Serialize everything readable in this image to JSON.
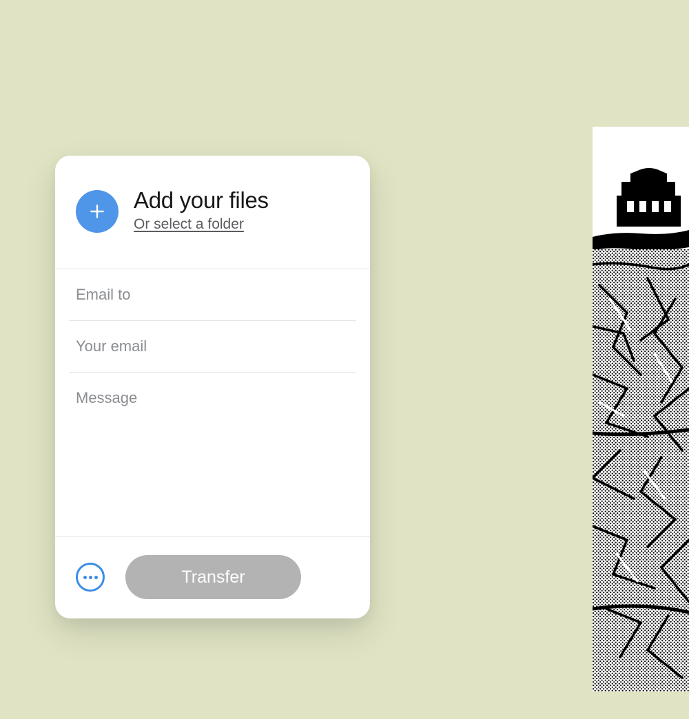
{
  "upload": {
    "title": "Add your files",
    "folder_link": "Or select a folder",
    "icon": "plus-icon"
  },
  "form": {
    "email_to_placeholder": "Email to",
    "your_email_placeholder": "Your email",
    "message_placeholder": "Message"
  },
  "footer": {
    "options_icon": "more-options-icon",
    "transfer_label": "Transfer"
  },
  "colors": {
    "background": "#e0e4c4",
    "accent": "#4f95e8",
    "accent_border": "#3b8de6",
    "button_disabled": "#b3b3b3",
    "text_primary": "#17181a",
    "text_secondary": "#8a8d91"
  }
}
